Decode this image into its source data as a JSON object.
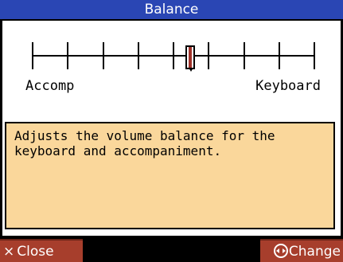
{
  "title": "Balance",
  "slider": {
    "ticks": 9,
    "value_index": 4,
    "left_label": "Accomp",
    "right_label": "Keyboard"
  },
  "description": "Adjusts the volume balance for the keyboard and accompaniment.",
  "footer": {
    "close_icon": "×",
    "close_label": "Close",
    "change_label": "Change",
    "change_icon": "left-right-circle-icon"
  },
  "colors": {
    "title_bar": "#2a46b4",
    "desc_box": "#fad79b",
    "button": "#a73e2c",
    "knob_accent": "#a0322a"
  }
}
